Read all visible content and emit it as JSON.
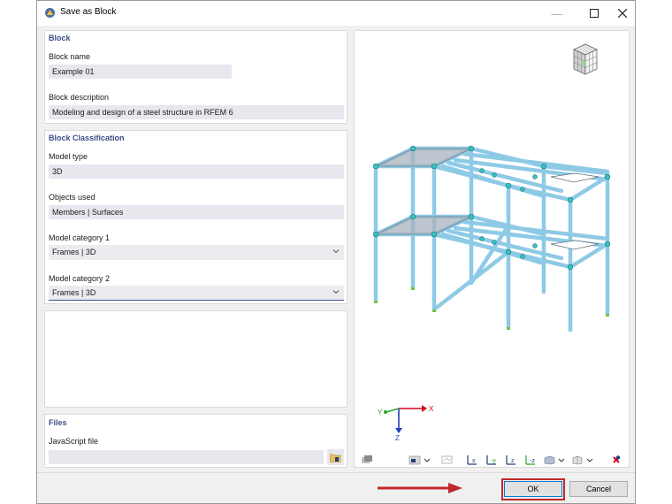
{
  "window": {
    "title": "Save as Block"
  },
  "block": {
    "section_title": "Block",
    "name_label": "Block name",
    "name_value": "Example 01",
    "description_label": "Block description",
    "description_value": "Modeling and design of a steel structure in RFEM 6"
  },
  "classification": {
    "section_title": "Block Classification",
    "model_type_label": "Model type",
    "model_type_value": "3D",
    "objects_used_label": "Objects used",
    "objects_used_value": "Members | Surfaces",
    "category1_label": "Model category 1",
    "category1_value": "Frames | 3D",
    "category2_label": "Model category 2",
    "category2_value": "Frames | 3D"
  },
  "files": {
    "section_title": "Files",
    "js_label": "JavaScript file",
    "js_value": ""
  },
  "viewport": {
    "axis_x": "X",
    "axis_y": "Y",
    "axis_z": "Z",
    "toolbar_icons": [
      "render-icon",
      "view-options-icon",
      "wireframe-icon",
      "view-x-icon",
      "view-neg-y-icon",
      "view-z-icon",
      "view-neg-z-icon",
      "display-mode-icon",
      "iso-view-icon",
      "reset-icon"
    ]
  },
  "buttons": {
    "ok": "OK",
    "cancel": "Cancel"
  },
  "colors": {
    "accent": "#3b4e86",
    "member": "#8ecae6",
    "highlight": "#c0282b"
  }
}
